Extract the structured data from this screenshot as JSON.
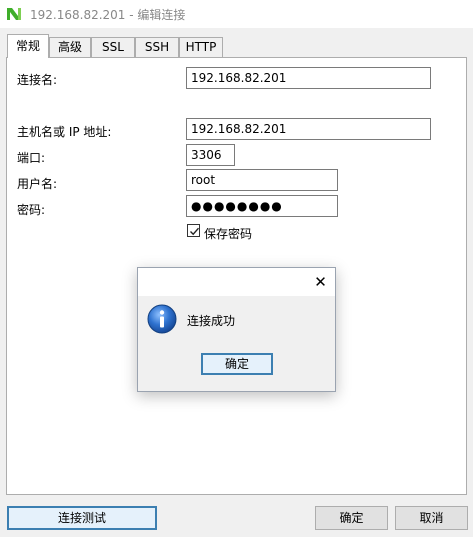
{
  "window": {
    "title": "192.168.82.201 - 编辑连接",
    "icon": "navicat-app-icon"
  },
  "tabs": [
    {
      "label": "常规",
      "active": true
    },
    {
      "label": "高级",
      "active": false
    },
    {
      "label": "SSL",
      "active": false
    },
    {
      "label": "SSH",
      "active": false
    },
    {
      "label": "HTTP",
      "active": false
    }
  ],
  "form": {
    "connection_name": {
      "label": "连接名:",
      "value": "192.168.82.201"
    },
    "host": {
      "label": "主机名或 IP 地址:",
      "value": "192.168.82.201"
    },
    "port": {
      "label": "端口:",
      "value": "3306"
    },
    "username": {
      "label": "用户名:",
      "value": "root"
    },
    "password": {
      "label": "密码:",
      "value": "●●●●●●●●"
    },
    "save_password": {
      "label": "保存密码",
      "checked": true
    }
  },
  "dialog": {
    "close_glyph": "✕",
    "icon": "info-icon",
    "message": "连接成功",
    "ok_label": "确定"
  },
  "buttons": {
    "test_connection": "连接测试",
    "ok": "确定",
    "cancel": "取消"
  },
  "colors": {
    "accent_border": "#3c7fb1",
    "accent_fill": "#e5f1fb",
    "info_blue": "#1e5fb3",
    "app_icon_green": "#3fae2a"
  }
}
